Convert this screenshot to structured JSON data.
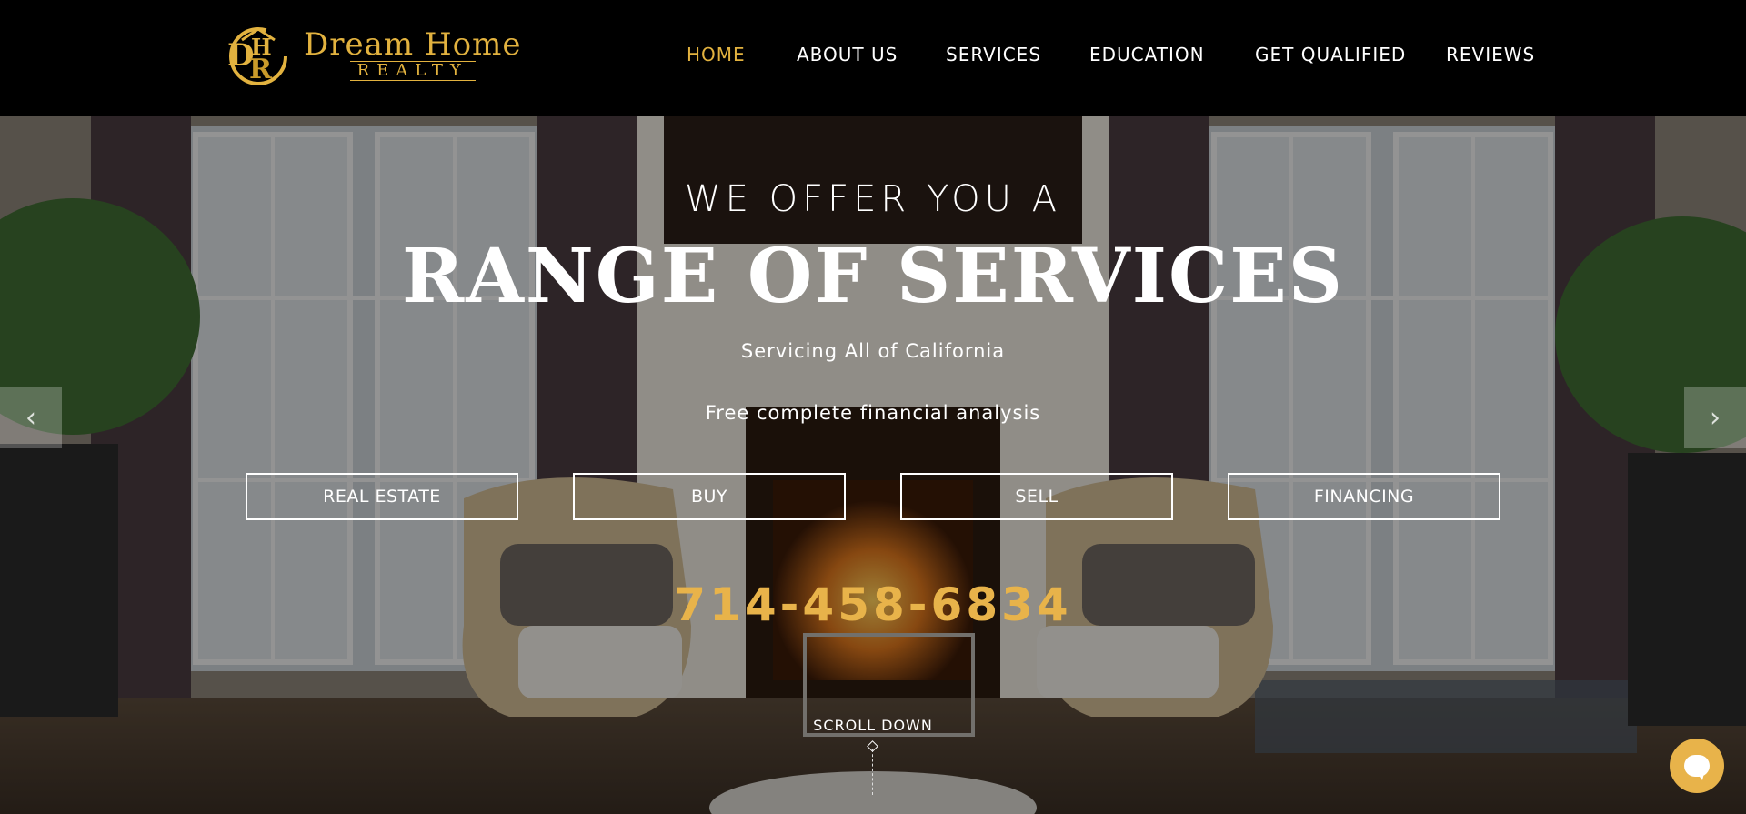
{
  "logo": {
    "title": "Dream Home",
    "subtitle": "REALTY",
    "monogram": "DHR",
    "color": "#e2b23f"
  },
  "nav": {
    "items": [
      "HOME",
      "ABOUT US",
      "SERVICES",
      "EDUCATION",
      "GET QUALIFIED",
      "REVIEWS"
    ],
    "active_index": 0,
    "active_color": "#e2b23f"
  },
  "hero": {
    "pre_title": "WE OFFER YOU A",
    "title": "RANGE OF SERVICES",
    "subtitle_1": "Servicing All of California",
    "subtitle_2": "Free complete financial analysis",
    "buttons": [
      "REAL ESTATE",
      "BUY",
      "SELL",
      "FINANCING"
    ],
    "phone": "714-458-6834",
    "phone_color": "#e8b34a",
    "scroll_label": "SCROLL DOWN"
  },
  "slider": {
    "prev_icon": "chevron-left-icon",
    "next_icon": "chevron-right-icon"
  },
  "chat": {
    "icon": "chat-bubble-icon",
    "color": "#e8b34a"
  }
}
